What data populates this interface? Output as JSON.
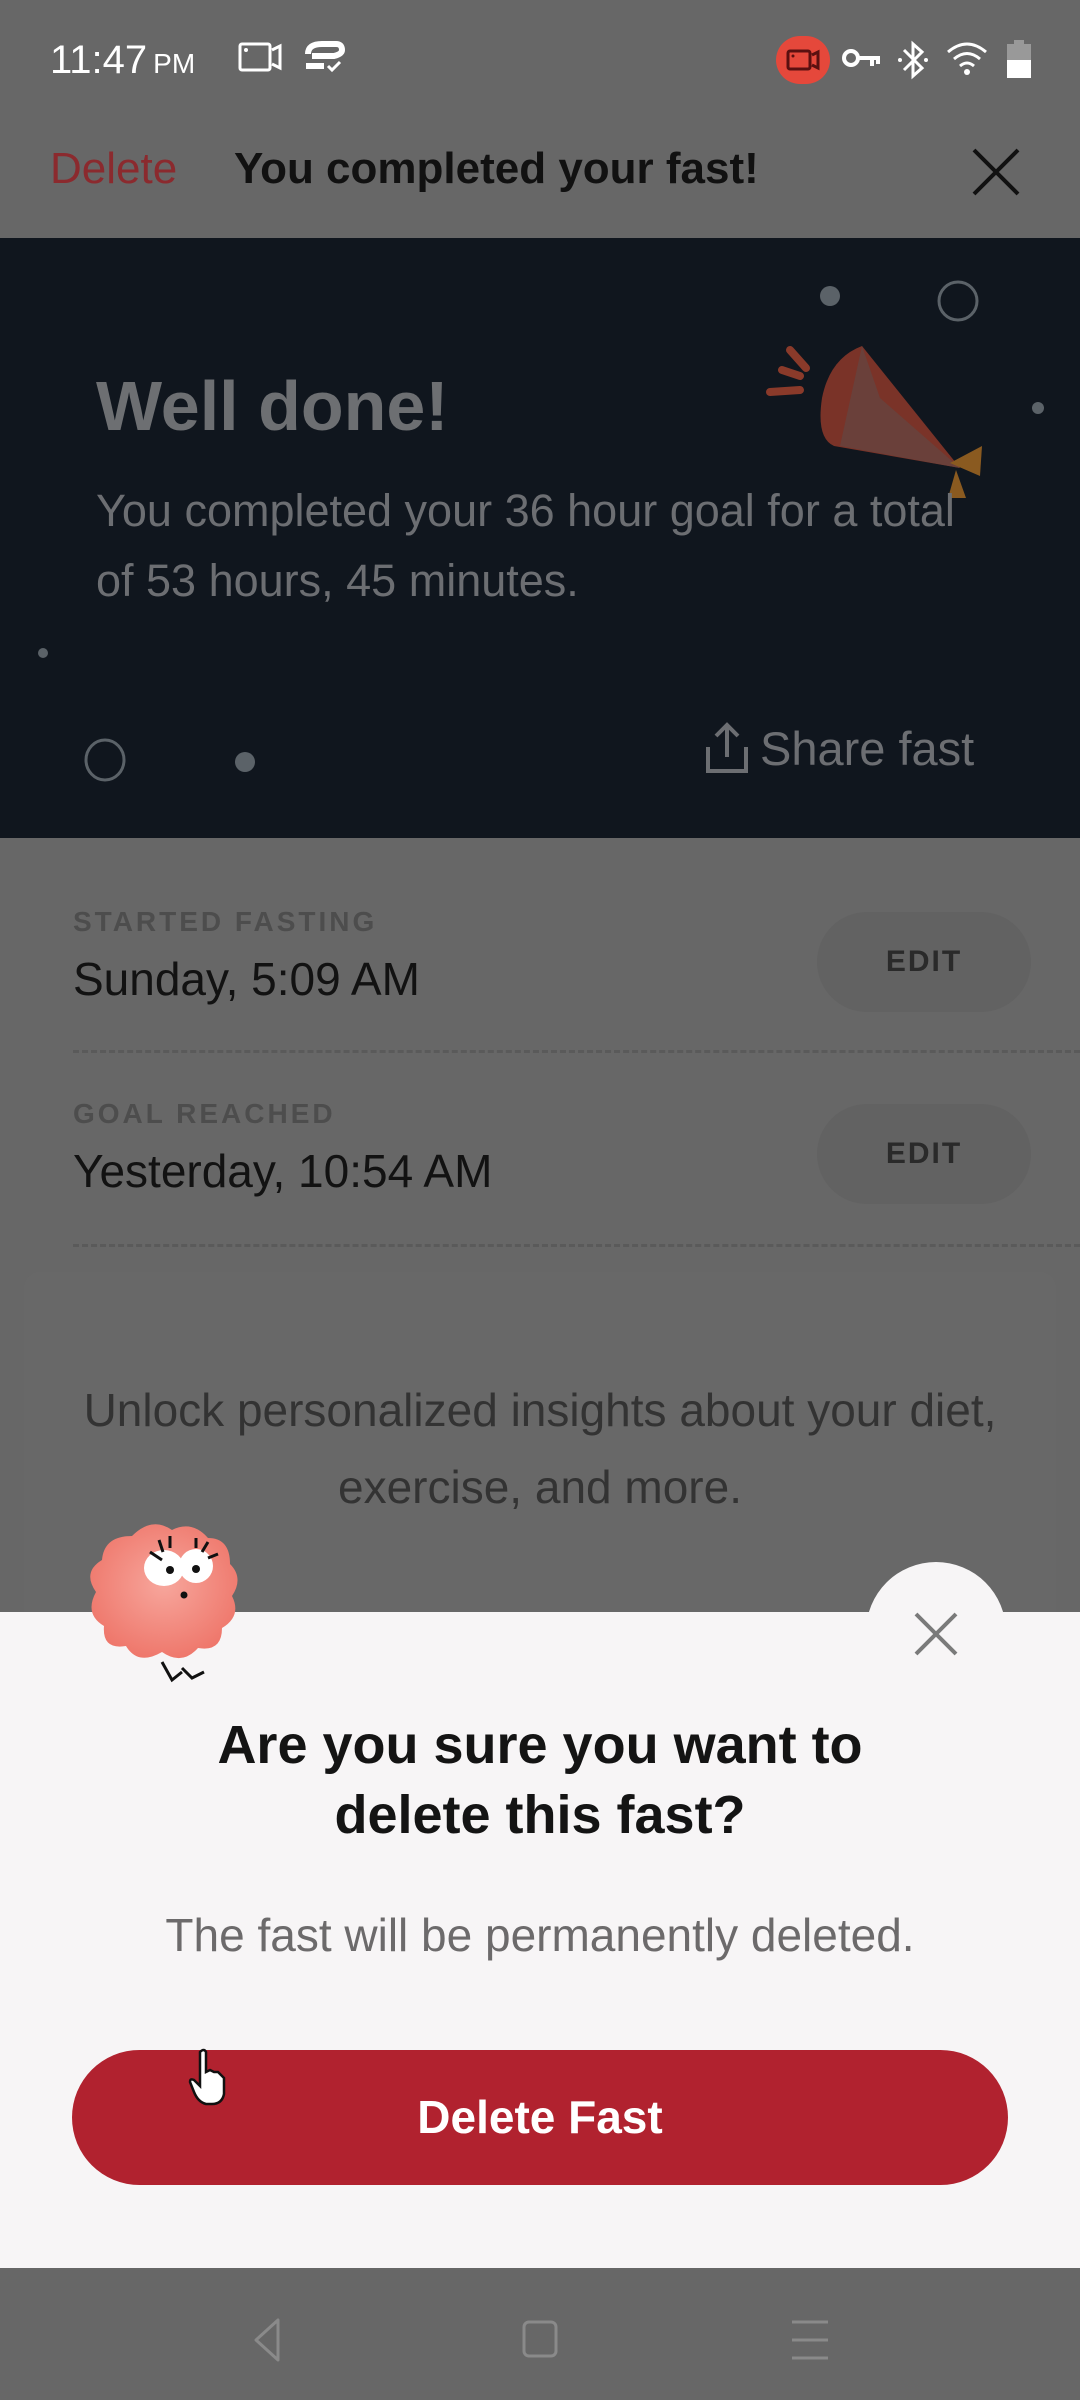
{
  "status_bar": {
    "time": "11:47",
    "ampm": "PM",
    "icons": [
      "screen-record-icon",
      "sync-check-icon",
      "recording-active-icon",
      "vpn-key-icon",
      "bluetooth-icon",
      "wifi-icon",
      "battery-icon"
    ],
    "record_color": "#e5483b"
  },
  "header": {
    "delete_label": "Delete",
    "title": "You completed your fast!",
    "close_icon": "close-icon"
  },
  "hero": {
    "title": "Well done!",
    "subtitle": "You completed your 36 hour goal for a total of 53 hours, 45 minutes.",
    "share_label": "Share fast",
    "share_icon": "share-icon",
    "decoration": "party-popper-icon"
  },
  "rows": [
    {
      "label": "STARTED FASTING",
      "value": "Sunday, 5:09 AM",
      "action": "EDIT"
    },
    {
      "label": "GOAL REACHED",
      "value": "Yesterday, 10:54 AM",
      "action": "EDIT"
    }
  ],
  "promo": {
    "text": "Unlock personalized insights about your diet, exercise, and more."
  },
  "dialog": {
    "title": "Are you sure you want to delete this fast?",
    "message": "The fast will be permanently deleted.",
    "confirm_label": "Delete Fast",
    "close_icon": "close-icon",
    "mascot": "mascot-icon",
    "accent_color": "#b1222f"
  },
  "nav_bar": {
    "buttons": [
      "back-icon",
      "home-icon",
      "recents-icon"
    ]
  }
}
